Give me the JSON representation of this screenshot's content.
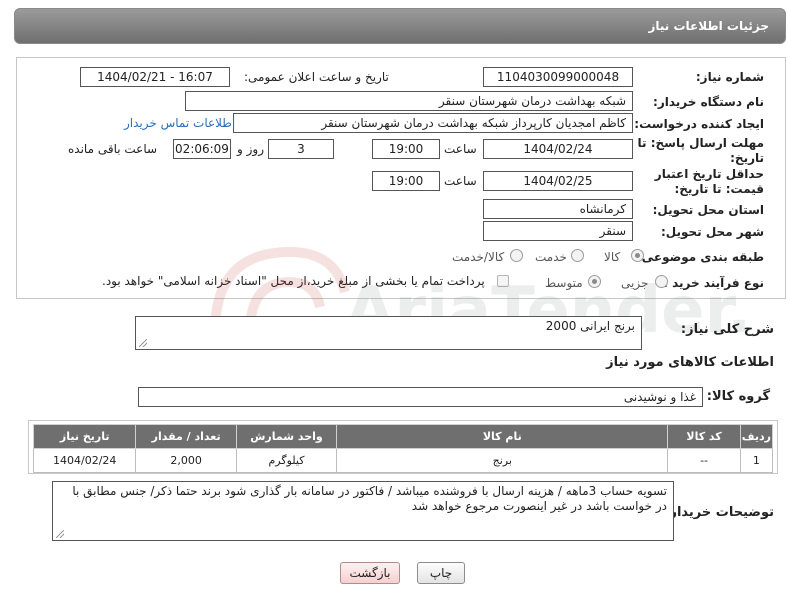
{
  "header": {
    "title": "جزئیات اطلاعات نیاز"
  },
  "form": {
    "need_number": {
      "label": "شماره نیاز:",
      "value": "1104030099000048"
    },
    "announce_date": {
      "label": "تاریخ و ساعت اعلان عمومی:",
      "value": "1404/02/21 - 16:07"
    },
    "buyer_org": {
      "label": "نام دستگاه خریدار:",
      "value": "شبکه بهداشت درمان شهرستان سنقر"
    },
    "creator": {
      "label": "ایجاد کننده درخواست:",
      "value": "کاظم امجدیان کارپرداز شبکه بهداشت درمان شهرستان سنقر",
      "contact_link": "اطلاعات تماس خریدار"
    },
    "reply_deadline": {
      "label": "مهلت ارسال پاسخ: تا تاریخ:",
      "date": "1404/02/24",
      "time_label": "ساعت",
      "time": "19:00",
      "days": "3",
      "days_label": "روز و",
      "remaining": "02:06:09",
      "remaining_label": "ساعت باقی مانده"
    },
    "price_validity": {
      "label": "حداقل تاریخ اعتبار قیمت: تا تاریخ:",
      "date": "1404/02/25",
      "time_label": "ساعت",
      "time": "19:00"
    },
    "province": {
      "label": "استان محل تحویل:",
      "value": "کرمانشاه"
    },
    "city": {
      "label": "شهر محل تحویل:",
      "value": "سنقر"
    },
    "category": {
      "label": "طبقه بندی موضوعی:",
      "options": [
        "کالا",
        "خدمت",
        "کالا/خدمت"
      ],
      "selected": "کالا"
    },
    "process": {
      "label": "نوع فرآیند خرید :",
      "options": [
        "جزیی",
        "متوسط"
      ],
      "selected": "متوسط",
      "payment_note": "پرداخت تمام یا بخشی از مبلغ خرید،از محل \"اسناد خزانه اسلامی\" خواهد بود."
    }
  },
  "need_desc": {
    "label": "شرح کلی نیاز:",
    "value": "برنج ایرانی 2000"
  },
  "goods_section": {
    "title": "اطلاعات کالاهای مورد نیاز"
  },
  "goods_group": {
    "label": "گروه کالا:",
    "value": "غذا و نوشیدنی"
  },
  "table": {
    "headers": [
      "ردیف",
      "کد کالا",
      "نام کالا",
      "واحد شمارش",
      "تعداد / مقدار",
      "تاریخ نیاز"
    ],
    "rows": [
      {
        "row": "1",
        "code": "--",
        "name": "برنج",
        "unit": "کیلوگرم",
        "qty": "2,000",
        "date": "1404/02/24"
      }
    ]
  },
  "buyer_notes": {
    "label": "توضیحات خریدار:",
    "value": "تسویه حساب 3ماهه / هزینه ارسال با فروشنده میباشد / فاکتور در سامانه بار گذاری شود برند حتما ذکر/ جنس مطابق با در خواست باشد در غیر اینصورت مرجوع خواهد شد"
  },
  "buttons": {
    "print": "چاپ",
    "back": "بازگشت"
  },
  "watermark": {
    "text": "AriaTender.net"
  },
  "colors": {
    "header_bg": "#7f7f7f",
    "link": "#2a6ebb",
    "watermark": "#c0392b"
  }
}
